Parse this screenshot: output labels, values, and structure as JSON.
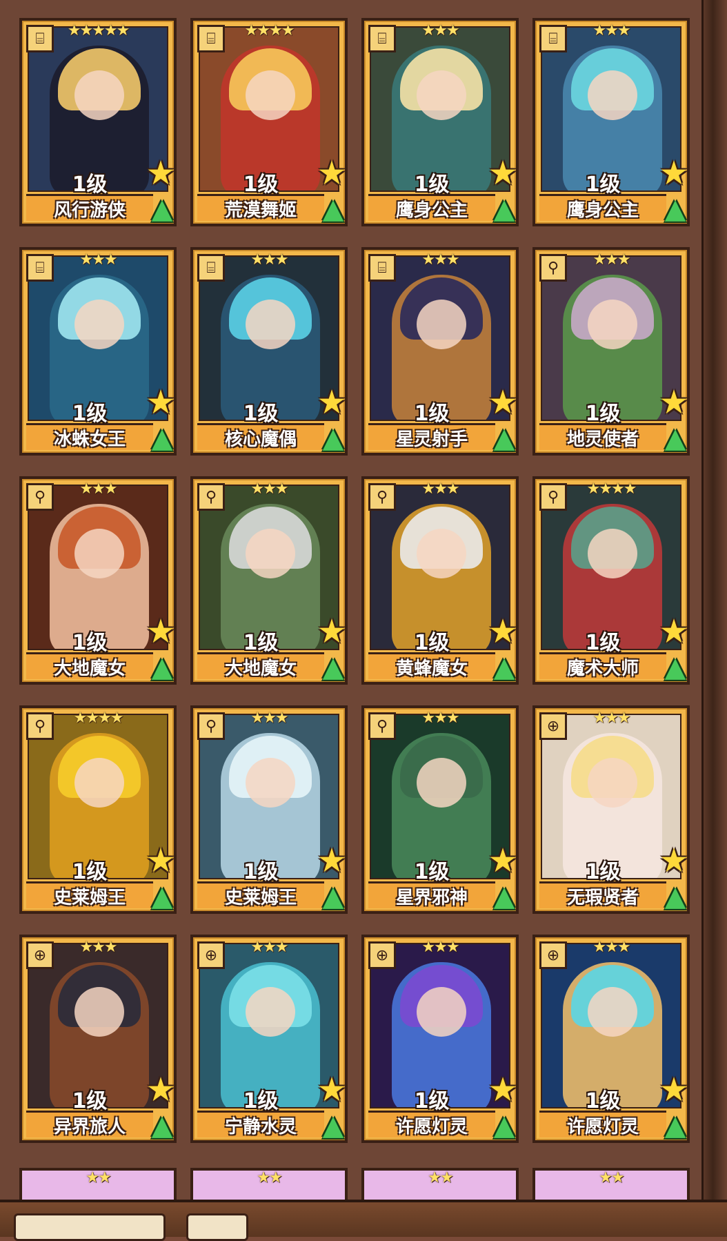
{
  "cards": [
    {
      "name": "风行游侠",
      "level": "1级",
      "stars": "★★★★★",
      "class_icon": "scroll-icon",
      "palette": [
        "#2a3a5a",
        "#f3c86a",
        "#1b1b2a"
      ]
    },
    {
      "name": "荒漠舞姬",
      "level": "1级",
      "stars": "★★★★",
      "class_icon": "scroll-icon",
      "palette": [
        "#8a4a2a",
        "#f7c85a",
        "#c2352a"
      ]
    },
    {
      "name": "鹰身公主",
      "level": "1级",
      "stars": "★★★",
      "class_icon": "scroll-icon",
      "palette": [
        "#3a4a3a",
        "#f6e2a6",
        "#3a7a7a"
      ]
    },
    {
      "name": "鹰身公主",
      "level": "1级",
      "stars": "★★★",
      "class_icon": "scroll-icon",
      "palette": [
        "#2a4a6a",
        "#6ad6e0",
        "#4a8ab0"
      ]
    },
    {
      "name": "冰蛛女王",
      "level": "1级",
      "stars": "★★★",
      "class_icon": "scroll-icon",
      "palette": [
        "#1e4a6a",
        "#9ee6f0",
        "#2a6a8a"
      ]
    },
    {
      "name": "核心魔偶",
      "level": "1级",
      "stars": "★★★",
      "class_icon": "scroll-icon",
      "palette": [
        "#22303a",
        "#5ad0e6",
        "#2a5a7a"
      ]
    },
    {
      "name": "星灵射手",
      "level": "1级",
      "stars": "★★★",
      "class_icon": "scroll-icon",
      "palette": [
        "#2a2a4a",
        "#2a2a5a",
        "#c7823a"
      ]
    },
    {
      "name": "地灵使者",
      "level": "1级",
      "stars": "★★★",
      "class_icon": "staff-icon",
      "palette": [
        "#4a3a4a",
        "#c8a8c8",
        "#5a9a4a"
      ]
    },
    {
      "name": "大地魔女",
      "level": "1级",
      "stars": "★★★",
      "class_icon": "staff-icon",
      "palette": [
        "#5a2a1a",
        "#c85a2a",
        "#f4c2a2"
      ]
    },
    {
      "name": "大地魔女",
      "level": "1级",
      "stars": "★★★",
      "class_icon": "staff-icon",
      "palette": [
        "#3a4a2a",
        "#d8d8d8",
        "#6a8a5a"
      ]
    },
    {
      "name": "黄蜂魔女",
      "level": "1级",
      "stars": "★★★",
      "class_icon": "staff-icon",
      "palette": [
        "#2a2a3a",
        "#eaeaea",
        "#e2a22a"
      ]
    },
    {
      "name": "魔术大师",
      "level": "1级",
      "stars": "★★★★",
      "class_icon": "staff-icon",
      "palette": [
        "#2a3a3a",
        "#5aa08a",
        "#c23a3a"
      ]
    },
    {
      "name": "史莱姆王",
      "level": "1级",
      "stars": "★★★★",
      "class_icon": "staff-icon",
      "palette": [
        "#8a6a1a",
        "#f6cc2a",
        "#e0a020"
      ]
    },
    {
      "name": "史莱姆王",
      "level": "1级",
      "stars": "★★★",
      "class_icon": "staff-icon",
      "palette": [
        "#3a5a6a",
        "#e6f4f8",
        "#b8d8e6"
      ]
    },
    {
      "name": "星界邪神",
      "level": "1级",
      "stars": "★★★",
      "class_icon": "staff-icon",
      "palette": [
        "#1a3a2a",
        "#3a6a4a",
        "#4a8a5a"
      ]
    },
    {
      "name": "无瑕贤者",
      "level": "1级",
      "stars": "★★★",
      "class_icon": "cross-icon",
      "palette": [
        "#e0d2c0",
        "#f6dc8a",
        "#f6e8e0"
      ]
    },
    {
      "name": "异界旅人",
      "level": "1级",
      "stars": "★★★",
      "class_icon": "cross-icon",
      "palette": [
        "#3a2a2a",
        "#2a2a3a",
        "#8a4a2a"
      ]
    },
    {
      "name": "宁静水灵",
      "level": "1级",
      "stars": "★★★",
      "class_icon": "cross-icon",
      "palette": [
        "#2a5a6a",
        "#7ae0e8",
        "#4ac0d0"
      ]
    },
    {
      "name": "许愿灯灵",
      "level": "1级",
      "stars": "★★★",
      "class_icon": "cross-icon",
      "palette": [
        "#2a1a4a",
        "#7a4ad0",
        "#4a7ae0"
      ]
    },
    {
      "name": "许愿灯灵",
      "level": "1级",
      "stars": "★★★",
      "class_icon": "cross-icon",
      "palette": [
        "#1a3a6a",
        "#5ad6e6",
        "#f6c26a"
      ]
    }
  ],
  "partial_cards": [
    {
      "stars": "★★"
    },
    {
      "stars": "★★"
    },
    {
      "stars": "★★"
    },
    {
      "stars": "★★"
    }
  ]
}
